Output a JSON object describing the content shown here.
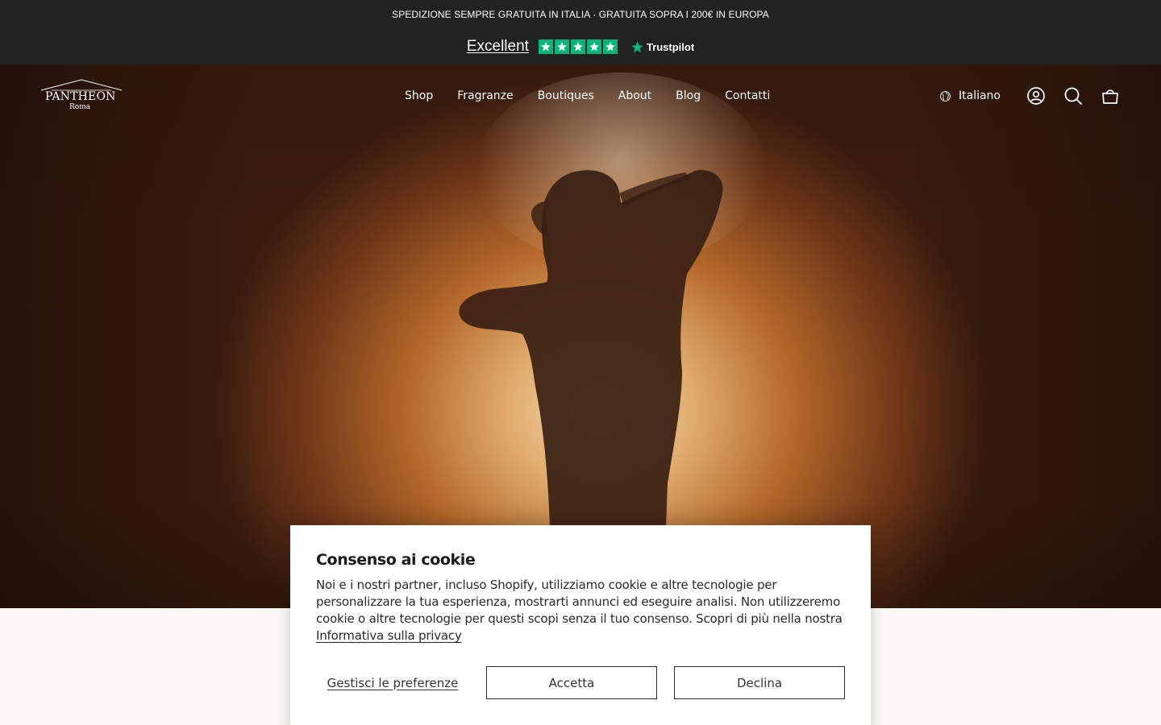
{
  "announcement": {
    "text": "SPEDIZIONE SEMPRE GRATUITA IN ITALIA · GRATUITA SOPRA I 200€ IN EUROPA"
  },
  "trustpilot": {
    "rating_label": "Excellent",
    "stars": 5,
    "brand": "Trustpilot",
    "star_color": "#00b67a"
  },
  "header": {
    "logo": {
      "name": "PANTHEON",
      "city": "Roma"
    },
    "nav": [
      "Shop",
      "Fragranze",
      "Boutiques",
      "About",
      "Blog",
      "Contatti"
    ],
    "language": "Italiano",
    "icons": [
      "globe-icon",
      "account-icon",
      "search-icon",
      "cart-icon"
    ]
  },
  "cookie_banner": {
    "title": "Consenso ai cookie",
    "body": "Noi e i nostri partner, incluso Shopify, utilizziamo cookie e altre tecnologie per personalizzare la tua esperienza, mostrarti annunci ed eseguire analisi. Non utilizzeremo cookie o altre tecnologie per questi scopi senza il tuo consenso. Scopri di più nella nostra",
    "privacy_link": "Informativa sulla privacy",
    "manage_label": "Gestisci le preferenze",
    "accept_label": "Accetta",
    "decline_label": "Declina"
  },
  "colors": {
    "topbar": "#222222",
    "page_bg": "#faf8f5",
    "hero_glow": "#f0d9b5"
  }
}
